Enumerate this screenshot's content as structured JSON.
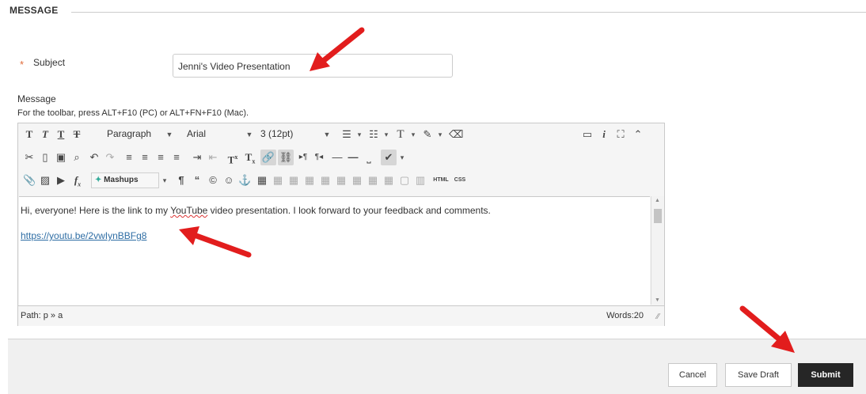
{
  "section": {
    "title": "MESSAGE"
  },
  "subject": {
    "required_mark": "*",
    "label": "Subject",
    "value": "Jenni's Video Presentation"
  },
  "message": {
    "label": "Message",
    "toolbar_hint": "For the toolbar, press ALT+F10 (PC) or ALT+FN+F10 (Mac)."
  },
  "toolbar": {
    "format_select": "Paragraph",
    "font_select": "Arial",
    "size_select": "3 (12pt)",
    "mashups_label": "Mashups",
    "html_label": "HTML",
    "css_label": "CSS"
  },
  "editor": {
    "text_prefix": "Hi, everyone! Here is the link to my ",
    "text_misspelled": "YouTube",
    "text_suffix": " video presentation. I look forward to your feedback and comments.",
    "link": "https://youtu.be/2vwIynBBFg8",
    "path": "Path: p » a",
    "words": "Words:20"
  },
  "actions": {
    "cancel": "Cancel",
    "save_draft": "Save Draft",
    "submit": "Submit"
  },
  "colors": {
    "required": "#e06a3a",
    "link": "#2e6da4",
    "submit_bg": "#262626",
    "arrow": "#e21d1d"
  }
}
